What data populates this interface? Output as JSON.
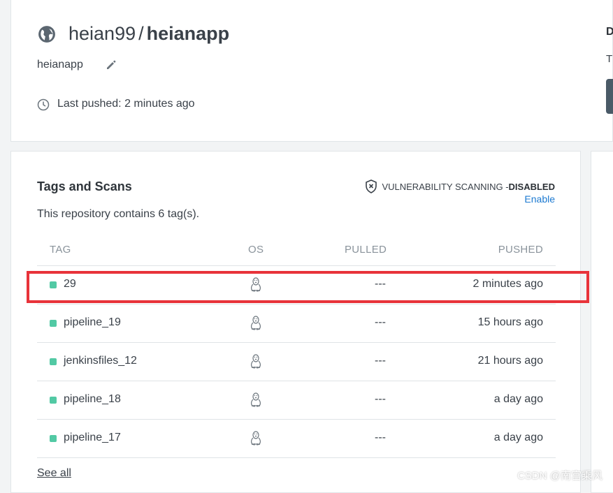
{
  "repo": {
    "namespace": "heian99",
    "separator": "/",
    "name": "heianapp",
    "description": "heianapp",
    "last_pushed": "Last pushed: 2 minutes ago"
  },
  "side_panel": {
    "heading_fragment": "D",
    "text_fragment": "T"
  },
  "tags_section": {
    "title": "Tags and Scans",
    "vuln_label": "VULNERABILITY SCANNING - ",
    "vuln_status": "DISABLED",
    "enable_link": "Enable",
    "summary": "This repository contains 6 tag(s).",
    "columns": {
      "tag": "TAG",
      "os": "OS",
      "pulled": "PULLED",
      "pushed": "PUSHED"
    },
    "rows": [
      {
        "tag": "29",
        "os_icon": "linux-tux-icon",
        "pulled": "---",
        "pushed": "2 minutes ago"
      },
      {
        "tag": "pipeline_19",
        "os_icon": "linux-tux-icon",
        "pulled": "---",
        "pushed": "15 hours ago"
      },
      {
        "tag": "jenkinsfiles_12",
        "os_icon": "linux-tux-icon",
        "pulled": "---",
        "pushed": "21 hours ago"
      },
      {
        "tag": "pipeline_18",
        "os_icon": "linux-tux-icon",
        "pulled": "---",
        "pushed": "a day ago"
      },
      {
        "tag": "pipeline_17",
        "os_icon": "linux-tux-icon",
        "pulled": "---",
        "pushed": "a day ago"
      }
    ],
    "see_all": "See all"
  },
  "watermark": "CSDN @南宫乘风",
  "colors": {
    "status_dot": "#52c9a4",
    "link": "#1d7ad1",
    "highlight": "#e8333a"
  },
  "icons": [
    "globe-icon",
    "pencil-icon",
    "clock-icon",
    "shield-x-icon",
    "linux-tux-icon"
  ]
}
